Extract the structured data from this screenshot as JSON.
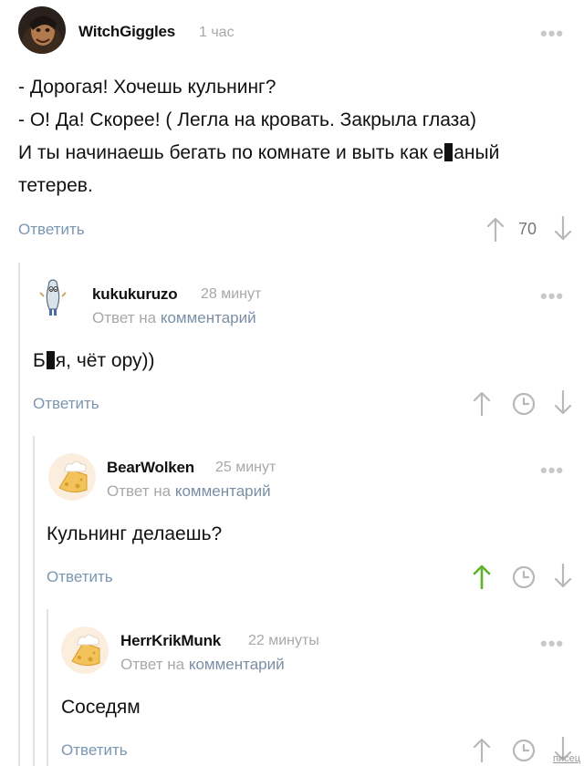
{
  "comments": [
    {
      "author": "WitchGiggles",
      "time": "1 час",
      "lines": [
        "- Дорогая! Хочешь кульнинг?",
        "- О! Да! Скорее! ( Легла на кровать. Закрыла глаза)",
        "И ты начинаешь бегать по комнате и выть как е",
        "аный",
        "тетерев."
      ],
      "reply_label": "Ответить",
      "rating": "70"
    },
    {
      "author": "kukukuruzo",
      "time": "28 минут",
      "reply_prefix": "Ответ на",
      "reply_link": "комментарий",
      "text_before": "Б",
      "text_after": "я, чёт ору))",
      "reply_label": "Ответить"
    },
    {
      "author": "BearWolken",
      "time": "25 минут",
      "reply_prefix": "Ответ на",
      "reply_link": "комментарий",
      "text": "Кульнинг делаешь?",
      "reply_label": "Ответить"
    },
    {
      "author": "HerrKrikMunk",
      "time": "22 минуты",
      "reply_prefix": "Ответ на",
      "reply_link": "комментарий",
      "text": "Соседям",
      "reply_label": "Ответить"
    }
  ],
  "more_glyph": "•••",
  "watermark": "писец",
  "colors": {
    "upvote_active": "#5fb32a",
    "icon_gray": "#b8b8b8",
    "link": "#7a96b0"
  },
  "icons": [
    "more-icon",
    "upvote-arrow-icon",
    "downvote-arrow-icon",
    "clock-icon"
  ]
}
